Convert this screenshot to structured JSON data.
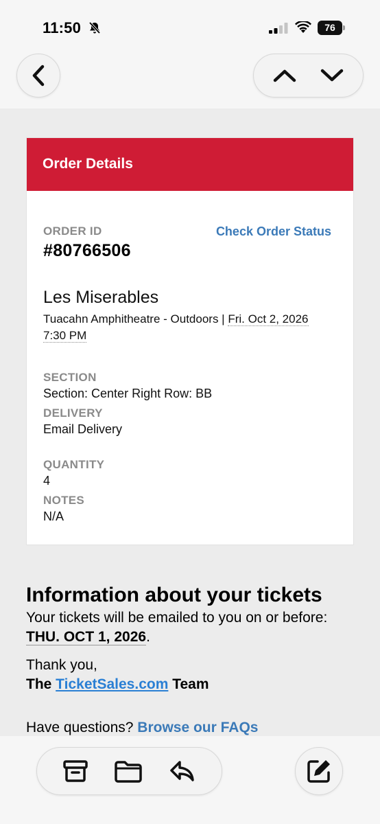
{
  "status_bar": {
    "time": "11:50",
    "battery": "76",
    "icons": [
      "bell-slash-icon",
      "signal-icon",
      "wifi-icon",
      "battery-icon"
    ]
  },
  "nav": {
    "icons": [
      "chevron-left-icon",
      "chevron-up-icon",
      "chevron-down-icon"
    ]
  },
  "order": {
    "header": "Order Details",
    "order_id_label": "ORDER ID",
    "order_id": "#80766506",
    "check_status": "Check Order Status",
    "event_name": "Les Miserables",
    "venue": "Tuacahn Amphitheatre - Outdoors | ",
    "date": "Fri. Oct 2, 2026 7:30 PM",
    "section_label": "SECTION",
    "section_value": "Section: Center Right Row: BB",
    "delivery_label": "DELIVERY",
    "delivery_value": "Email Delivery",
    "quantity_label": "QUANTITY",
    "quantity_value": "4",
    "notes_label": "NOTES",
    "notes_value": "N/A"
  },
  "info": {
    "title": "Information about your tickets",
    "text": "Your tickets will be emailed to you on or before:",
    "date": "THU. OCT 1, 2026",
    "date_suffix": ".",
    "thanks": "Thank you,",
    "team_prefix": "The ",
    "team_link": "TicketSales.com",
    "team_suffix": " Team",
    "questions": "Have questions? ",
    "faq_link": "Browse our FAQs"
  },
  "toolbar": {
    "icons": [
      "archive-icon",
      "folder-icon",
      "reply-icon",
      "compose-icon"
    ]
  },
  "colors": {
    "header_red": "#cf1c35",
    "link_blue": "#3b7ab8",
    "label_gray": "#8a8a8a"
  }
}
